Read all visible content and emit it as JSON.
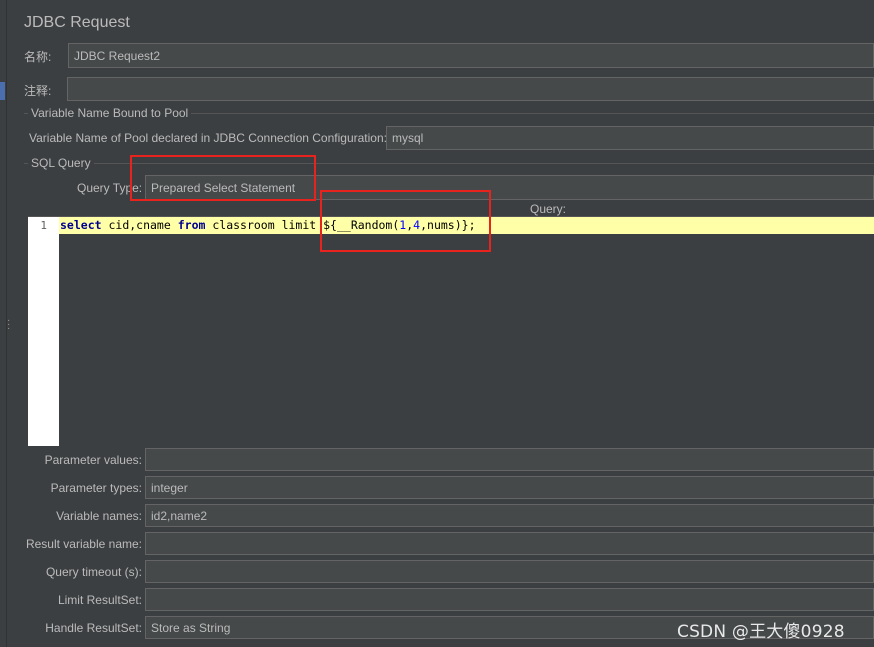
{
  "panel": {
    "title": "JDBC Request"
  },
  "name_field": {
    "label": "名称:",
    "value": "JDBC Request2"
  },
  "comment_field": {
    "label": "注释:",
    "value": ""
  },
  "pool_section": {
    "heading": "Variable Name Bound to Pool",
    "pool_label": "Variable Name of Pool declared in JDBC Connection Configuration:",
    "pool_value": "mysql"
  },
  "sql_section": {
    "heading": "SQL Query",
    "query_type_label": "Query Type:",
    "query_type_value": "Prepared Select Statement",
    "query_header": "Query:",
    "line_number": "1",
    "code": {
      "kw_select": "select",
      "part1": " cid,cname ",
      "kw_from": "from",
      "part2": " classroom limit ",
      "part3": "${__Random(",
      "n1": "1",
      "comma1": ",",
      "n2": "4",
      "part4": ",nums)};"
    }
  },
  "parameters": {
    "values_label": "Parameter values:",
    "values_value": "",
    "types_label": "Parameter types:",
    "types_value": "integer",
    "varnames_label": "Variable names:",
    "varnames_value": "id2,name2",
    "resultvar_label": "Result variable name:",
    "resultvar_value": "",
    "timeout_label": "Query timeout (s):",
    "timeout_value": "",
    "limit_label": "Limit ResultSet:",
    "limit_value": "",
    "handle_label": "Handle ResultSet:",
    "handle_value": "Store as String"
  },
  "watermark": "CSDN @王大傻0928",
  "colors": {
    "background": "#3c3f41",
    "field": "#45494a",
    "highlight_line": "#ffffa8",
    "annotation": "#e8231e"
  }
}
